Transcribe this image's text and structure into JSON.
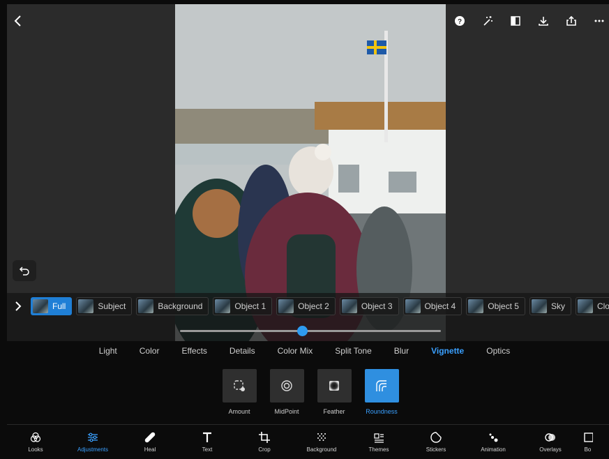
{
  "header": {
    "back_icon": "chevron-left-icon",
    "actions": [
      "help-icon",
      "magic-wand-icon",
      "compare-icon",
      "download-icon",
      "share-icon",
      "more-icon"
    ]
  },
  "mask_strip": {
    "items": [
      {
        "label": "Full",
        "active": true
      },
      {
        "label": "Subject",
        "active": false
      },
      {
        "label": "Background",
        "active": false
      },
      {
        "label": "Object 1",
        "active": false
      },
      {
        "label": "Object 2",
        "active": false
      },
      {
        "label": "Object 3",
        "active": false
      },
      {
        "label": "Object 4",
        "active": false
      },
      {
        "label": "Object 5",
        "active": false
      },
      {
        "label": "Sky",
        "active": false
      },
      {
        "label": "Clothes",
        "active": false
      }
    ]
  },
  "slider": {
    "value_fraction": 0.47
  },
  "adjust_tabs": {
    "items": [
      "Light",
      "Color",
      "Effects",
      "Details",
      "Color Mix",
      "Split Tone",
      "Blur",
      "Vignette",
      "Optics"
    ],
    "selected": "Vignette"
  },
  "vignette_tools": {
    "items": [
      {
        "label": "Amount",
        "icon": "amount-icon"
      },
      {
        "label": "MidPoint",
        "icon": "midpoint-icon"
      },
      {
        "label": "Feather",
        "icon": "feather-icon"
      },
      {
        "label": "Roundness",
        "icon": "roundness-icon"
      }
    ],
    "selected": "Roundness"
  },
  "bottom_nav": {
    "items": [
      {
        "label": "Looks",
        "icon": "looks-icon"
      },
      {
        "label": "Adjustments",
        "icon": "adjustments-icon"
      },
      {
        "label": "Heal",
        "icon": "bandage-icon"
      },
      {
        "label": "Text",
        "icon": "text-icon"
      },
      {
        "label": "Crop",
        "icon": "crop-icon"
      },
      {
        "label": "Background",
        "icon": "background-icon"
      },
      {
        "label": "Themes",
        "icon": "themes-icon"
      },
      {
        "label": "Stickers",
        "icon": "stickers-icon"
      },
      {
        "label": "Animation",
        "icon": "animation-icon"
      },
      {
        "label": "Overlays",
        "icon": "overlays-icon"
      },
      {
        "label": "Bo",
        "icon": "borders-icon"
      }
    ],
    "selected": "Adjustments"
  },
  "colors": {
    "accent": "#2e9bf0",
    "panel": "#2b2b2b",
    "background": "#0b0b0b"
  }
}
